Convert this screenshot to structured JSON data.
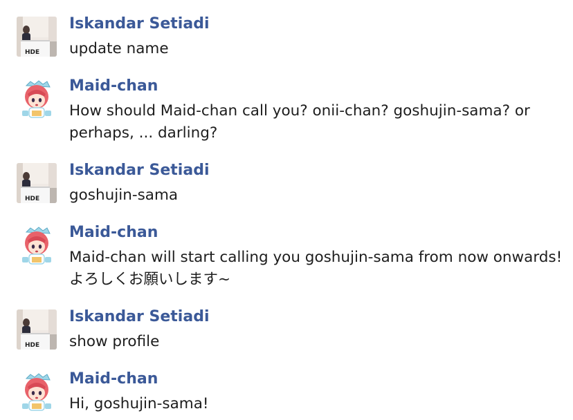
{
  "messages": [
    {
      "sender": "Iskandar Setiadi",
      "avatar_icon": "user-photo-icon",
      "lines": [
        "update name"
      ]
    },
    {
      "sender": "Maid-chan",
      "avatar_icon": "maid-chan-avatar-icon",
      "lines": [
        "How should Maid-chan call you? onii-chan? goshujin-sama? or",
        "perhaps, ... darling?"
      ]
    },
    {
      "sender": "Iskandar Setiadi",
      "avatar_icon": "user-photo-icon",
      "lines": [
        "goshujin-sama"
      ]
    },
    {
      "sender": "Maid-chan",
      "avatar_icon": "maid-chan-avatar-icon",
      "lines": [
        "Maid-chan will start calling you goshujin-sama from now onwards!",
        "よろしくお願いします~"
      ]
    },
    {
      "sender": "Iskandar Setiadi",
      "avatar_icon": "user-photo-icon",
      "lines": [
        "show profile"
      ]
    },
    {
      "sender": "Maid-chan",
      "avatar_icon": "maid-chan-avatar-icon",
      "lines": [
        "Hi, goshujin-sama!"
      ]
    }
  ],
  "avatar_logo_text": "HDE",
  "colors": {
    "sender_name": "#3b5998",
    "message_text": "#1d1d1d",
    "background": "#ffffff"
  }
}
